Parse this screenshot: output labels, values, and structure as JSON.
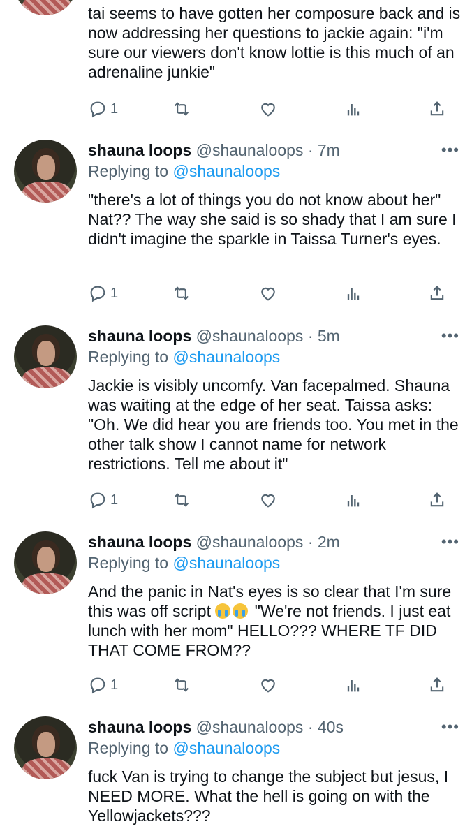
{
  "tweets": [
    {
      "name": "",
      "handle": "",
      "time": "",
      "reply_to": "",
      "text": "tai seems to have gotten her composure back and is now addressing her questions to jackie again: \"i'm sure our viewers don't know lottie is this much of an adrenaline junkie\"",
      "reply_count": "1"
    },
    {
      "name": "shauna loops",
      "handle": "@shaunaloops",
      "time": "7m",
      "reply_prefix": "Replying to",
      "reply_to": "@shaunaloops",
      "text": "\"there's a lot of things you do not know about her\" Nat?? The way she said is so shady that I am sure I didn't imagine the sparkle in Taissa Turner's eyes.",
      "reply_count": "1"
    },
    {
      "name": "shauna loops",
      "handle": "@shaunaloops",
      "time": "5m",
      "reply_prefix": "Replying to",
      "reply_to": "@shaunaloops",
      "text": "Jackie is visibly uncomfy. Van facepalmed. Shauna was waiting at the edge of her seat. Taissa asks: \"Oh. We did hear you are friends too. You met in the other talk show I cannot name for network restrictions. Tell me about it\"",
      "reply_count": "1"
    },
    {
      "name": "shauna loops",
      "handle": "@shaunaloops",
      "time": "2m",
      "reply_prefix": "Replying to",
      "reply_to": "@shaunaloops",
      "text_before_emoji": "And the panic in Nat's eyes is so clear that I'm sure this was off script ",
      "emoji": "loudly-crying-face",
      "text_after_emoji": " \"We're not friends. I just eat lunch with her mom\" HELLO??? WHERE TF DID THAT COME FROM??",
      "reply_count": "1"
    },
    {
      "name": "shauna loops",
      "handle": "@shaunaloops",
      "time": "40s",
      "reply_prefix": "Replying to",
      "reply_to": "@shaunaloops",
      "text": "fuck Van is trying to change the subject but jesus, I NEED MORE. What the hell is going on with the Yellowjackets???"
    }
  ],
  "separator": "·",
  "more_icon": "more-dots-icon",
  "colors": {
    "link": "#1d9bf0",
    "muted": "#536471",
    "text": "#0f1419",
    "thread_line": "#c9d1d8"
  }
}
